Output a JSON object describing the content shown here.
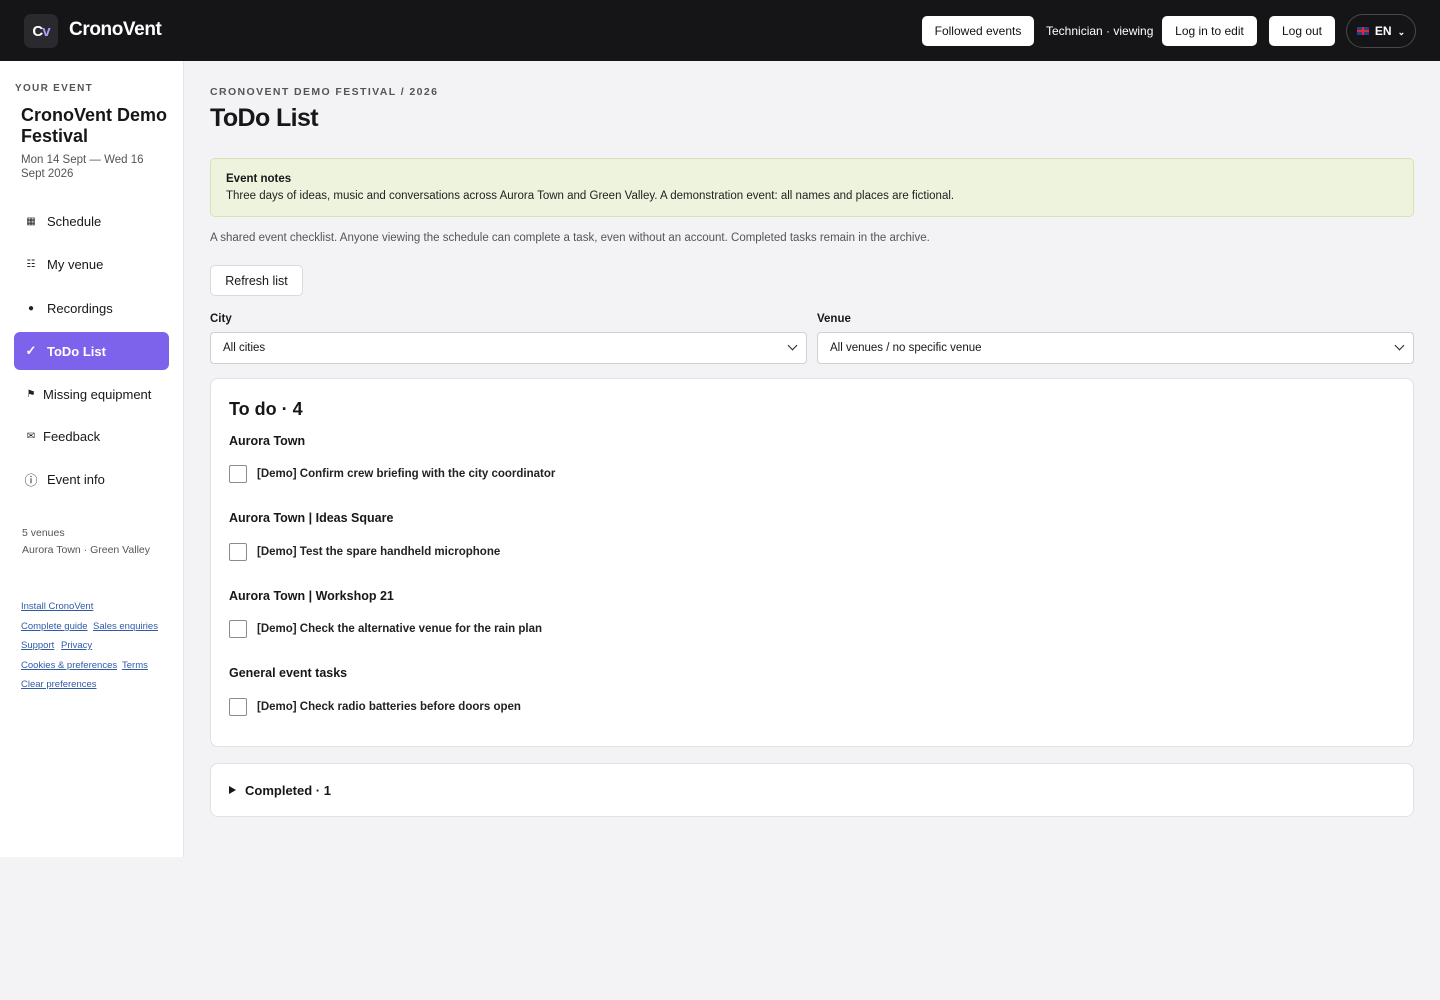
{
  "header": {
    "logo_text": "Cv",
    "brand": "CronoVent",
    "followed_events": "Followed events",
    "role_status": "Technician · viewing",
    "login": "Log in to edit",
    "logout": "Log out",
    "language": "EN"
  },
  "sidebar": {
    "eyebrow": "YOUR EVENT",
    "event_title": "CronoVent Demo Festival",
    "dates": "Mon 14 Sept — Wed 16 Sept 2026",
    "nav": [
      {
        "label": "Schedule",
        "icon": "grid-icon"
      },
      {
        "label": "My venue",
        "icon": "list-icon"
      },
      {
        "label": "Recordings",
        "icon": "record-dot-icon"
      },
      {
        "label": "ToDo List",
        "icon": "check-icon",
        "active": true
      },
      {
        "label": "Missing equipment",
        "icon": "flag-icon"
      },
      {
        "label": "Feedback",
        "icon": "envelope-icon"
      },
      {
        "label": "Event info",
        "icon": "info-icon"
      }
    ],
    "venues_count": "5 venues",
    "venues_cities": "Aurora Town · Green Valley",
    "links": {
      "install": "Install CronoVent",
      "guide": "Complete guide",
      "sales": "Sales enquiries",
      "support": "Support",
      "privacy": "Privacy",
      "cookies": "Cookies & preferences",
      "terms": "Terms",
      "clear": "Clear preferences"
    }
  },
  "main": {
    "breadcrumb": "CRONOVENT DEMO FESTIVAL / 2026",
    "title": "ToDo List",
    "notes_title": "Event notes",
    "notes_body": "Three days of ideas, music and conversations across Aurora Town and Green Valley. A demonstration event: all names and places are fictional.",
    "intro": "A shared event checklist. Anyone viewing the schedule can complete a task, even without an account. Completed tasks remain in the archive.",
    "refresh": "Refresh list",
    "city_label": "City",
    "city_value": "All cities",
    "venue_label": "Venue",
    "venue_value": "All venues / no specific venue",
    "todo_title": "To do · 4",
    "groups": [
      {
        "heading": "Aurora Town",
        "task": "[Demo] Confirm crew briefing with the city coordinator"
      },
      {
        "heading": "Aurora Town | Ideas Square",
        "task": "[Demo] Test the spare handheld microphone"
      },
      {
        "heading": "Aurora Town | Workshop 21",
        "task": "[Demo] Check the alternative venue for the rain plan"
      },
      {
        "heading": "General event tasks",
        "task": "[Demo] Check radio batteries before doors open"
      }
    ],
    "completed": "Completed · 1"
  },
  "colors": {
    "accent": "#7d63ec",
    "topbar": "#151517",
    "notes_bg": "#eef3dd"
  }
}
